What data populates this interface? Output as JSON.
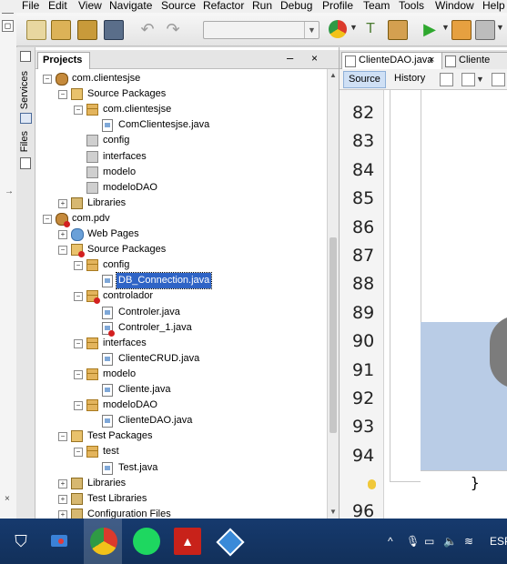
{
  "menu": [
    "File",
    "Edit",
    "View",
    "Navigate",
    "Source",
    "Refactor",
    "Run",
    "Debug",
    "Profile",
    "Team",
    "Tools",
    "Window",
    "Help"
  ],
  "side_tabs": [
    "Services",
    "Files"
  ],
  "projects_panel": {
    "tab_label": "Projects",
    "minimize": "–",
    "close": "×"
  },
  "tree": [
    {
      "label": "com.clientesjse",
      "depth": 0,
      "icon": "project-icon",
      "toggle": "−"
    },
    {
      "label": "Source Packages",
      "depth": 1,
      "icon": "source-packages-icon",
      "toggle": "−"
    },
    {
      "label": "com.clientesjse",
      "depth": 2,
      "icon": "package-icon",
      "toggle": "−"
    },
    {
      "label": "ComClientesjse.java",
      "depth": 3,
      "icon": "java-file-icon"
    },
    {
      "label": "config",
      "depth": 2,
      "icon": "empty-package-icon"
    },
    {
      "label": "interfaces",
      "depth": 2,
      "icon": "empty-package-icon"
    },
    {
      "label": "modelo",
      "depth": 2,
      "icon": "empty-package-icon"
    },
    {
      "label": "modeloDAO",
      "depth": 2,
      "icon": "empty-package-icon"
    },
    {
      "label": "Libraries",
      "depth": 1,
      "icon": "libraries-icon",
      "toggle": "+"
    },
    {
      "label": "com.pdv",
      "depth": 0,
      "icon": "project-error-icon",
      "toggle": "−"
    },
    {
      "label": "Web Pages",
      "depth": 1,
      "icon": "web-pages-icon",
      "toggle": "+"
    },
    {
      "label": "Source Packages",
      "depth": 1,
      "icon": "source-packages-error-icon",
      "toggle": "−"
    },
    {
      "label": "config",
      "depth": 2,
      "icon": "package-icon",
      "toggle": "−"
    },
    {
      "label": "DB_Connection.java",
      "depth": 3,
      "icon": "java-file-icon",
      "selected": true
    },
    {
      "label": "controlador",
      "depth": 2,
      "icon": "package-error-icon",
      "toggle": "−"
    },
    {
      "label": "Controler.java",
      "depth": 3,
      "icon": "java-file-icon"
    },
    {
      "label": "Controler_1.java",
      "depth": 3,
      "icon": "java-file-error-icon"
    },
    {
      "label": "interfaces",
      "depth": 2,
      "icon": "package-icon",
      "toggle": "−"
    },
    {
      "label": "ClienteCRUD.java",
      "depth": 3,
      "icon": "java-file-icon"
    },
    {
      "label": "modelo",
      "depth": 2,
      "icon": "package-icon",
      "toggle": "−"
    },
    {
      "label": "Cliente.java",
      "depth": 3,
      "icon": "java-file-icon"
    },
    {
      "label": "modeloDAO",
      "depth": 2,
      "icon": "package-icon",
      "toggle": "−"
    },
    {
      "label": "ClienteDAO.java",
      "depth": 3,
      "icon": "java-file-icon"
    },
    {
      "label": "Test Packages",
      "depth": 1,
      "icon": "test-packages-icon",
      "toggle": "−"
    },
    {
      "label": "test",
      "depth": 2,
      "icon": "package-icon",
      "toggle": "−"
    },
    {
      "label": "Test.java",
      "depth": 3,
      "icon": "java-file-icon"
    },
    {
      "label": "Libraries",
      "depth": 1,
      "icon": "libraries-icon",
      "toggle": "+"
    },
    {
      "label": "Test Libraries",
      "depth": 1,
      "icon": "libraries-icon",
      "toggle": "+"
    },
    {
      "label": "Configuration Files",
      "depth": 1,
      "icon": "config-files-icon",
      "toggle": "+"
    }
  ],
  "editor": {
    "tabs": [
      {
        "label": "ClienteDAO.java",
        "close": "×",
        "active": true
      },
      {
        "label": "Cliente",
        "active": false
      }
    ],
    "source_button": "Source",
    "history_button": "History",
    "line_numbers": [
      "82",
      "83",
      "84",
      "85",
      "86",
      "87",
      "88",
      "89",
      "90",
      "91",
      "92",
      "93",
      "94",
      "96"
    ],
    "code_brace": "}"
  },
  "tray": {
    "caret": "^",
    "language": "ESP"
  },
  "colors": {
    "selection": "#2f64c6",
    "taskbar": "#163a6e",
    "highlight": "#b9cce6"
  }
}
